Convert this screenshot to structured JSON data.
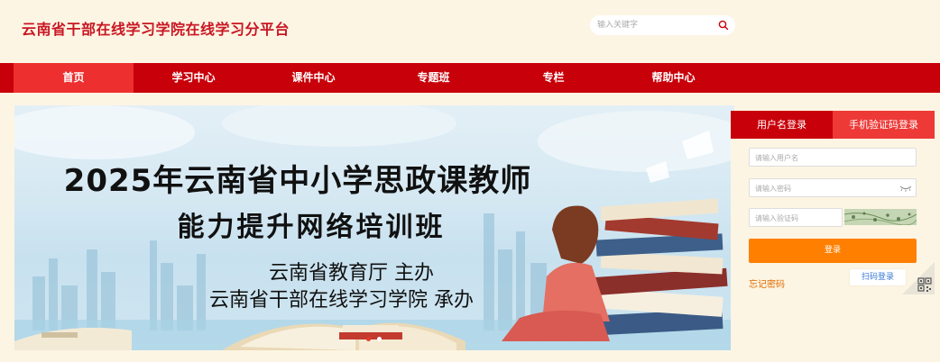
{
  "header": {
    "site_title": "云南省干部在线学习学院在线学习分平台",
    "search_placeholder": "输入关键字"
  },
  "nav": {
    "items": [
      {
        "label": "首页",
        "active": true
      },
      {
        "label": "学习中心"
      },
      {
        "label": "课件中心"
      },
      {
        "label": "专题班"
      },
      {
        "label": "专栏"
      },
      {
        "label": "帮助中心"
      }
    ]
  },
  "banner": {
    "title_line1": "2025年云南省中小学思政课教师",
    "title_line2": "能力提升网络培训班",
    "organizer_line1": "云南省教育厅  主办",
    "organizer_line2": "云南省干部在线学习学院  承办",
    "dots": [
      {
        "active": true
      },
      {
        "active": false
      }
    ]
  },
  "login": {
    "tabs": [
      "用户名登录",
      "手机验证码登录"
    ],
    "username_placeholder": "请输入用户名",
    "password_placeholder": "请输入密码",
    "captcha_placeholder": "请输入验证码",
    "login_button": "登录",
    "forgot_password": "忘记密码",
    "qr_login": "扫码登录"
  },
  "colors": {
    "brand_red": "#c8000a",
    "active_red": "#ee2f2f",
    "orange": "#ff7f00",
    "cream": "#fdf5e3"
  }
}
